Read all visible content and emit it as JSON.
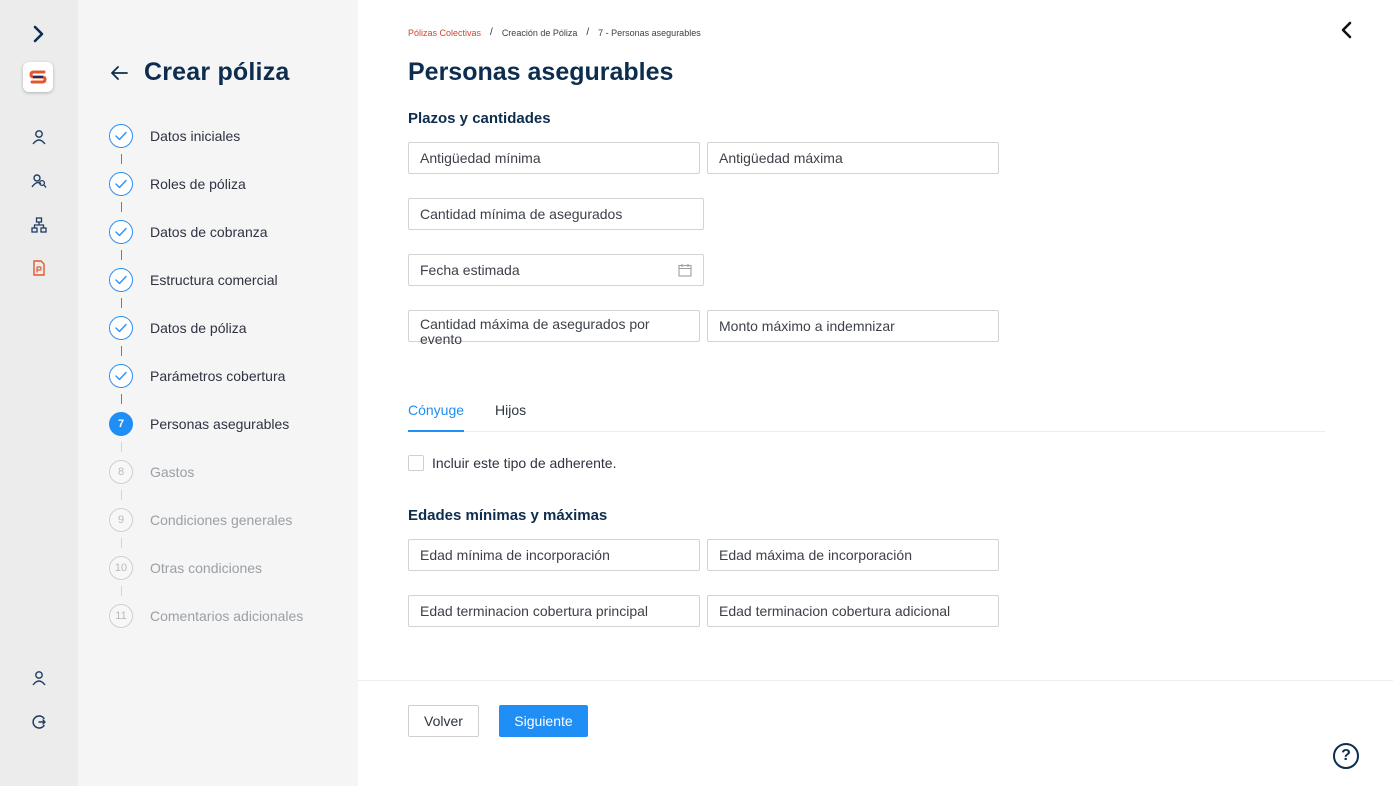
{
  "sidebar": {
    "logo_letter": "S",
    "nav_icons": [
      "chevron-right-icon",
      "user-icon",
      "users-search-icon",
      "org-chart-icon",
      "document-icon"
    ],
    "bottom_icons": [
      "user-icon",
      "logout-icon"
    ],
    "colors": {
      "rail_bg": "#ececec",
      "icon": "#1f3b63",
      "active_icon": "#e4572e"
    }
  },
  "steps_panel": {
    "title": "Crear póliza",
    "steps": [
      {
        "number": "1",
        "label": "Datos iniciales",
        "status": "done"
      },
      {
        "number": "2",
        "label": "Roles de póliza",
        "status": "done"
      },
      {
        "number": "3",
        "label": "Datos de cobranza",
        "status": "done"
      },
      {
        "number": "4",
        "label": "Estructura comercial",
        "status": "done"
      },
      {
        "number": "5",
        "label": "Datos de póliza",
        "status": "done"
      },
      {
        "number": "6",
        "label": "Parámetros cobertura",
        "status": "done"
      },
      {
        "number": "7",
        "label": "Personas asegurables",
        "status": "active"
      },
      {
        "number": "8",
        "label": "Gastos",
        "status": "todo"
      },
      {
        "number": "9",
        "label": "Condiciones generales",
        "status": "todo"
      },
      {
        "number": "10",
        "label": "Otras condiciones",
        "status": "todo"
      },
      {
        "number": "11",
        "label": "Comentarios adicionales",
        "status": "todo"
      }
    ]
  },
  "breadcrumb": {
    "items": [
      "Pólizas Colectivas",
      "Creación de Póliza",
      "7 - Personas asegurables"
    ],
    "separator": "/"
  },
  "main": {
    "title": "Personas asegurables",
    "plazos_section": {
      "title": "Plazos y cantidades",
      "fields": {
        "antiguedad_minima": "Antigüedad mínima",
        "antiguedad_maxima": "Antigüedad máxima",
        "cantidad_minima": "Cantidad mínima de asegurados",
        "fecha_estimada": "Fecha estimada",
        "cantidad_maxima_evento": "Cantidad máxima de asegurados por evento",
        "monto_maximo": "Monto máximo a indemnizar"
      }
    },
    "tabs": [
      {
        "label": "Cónyuge",
        "active": true
      },
      {
        "label": "Hijos",
        "active": false
      }
    ],
    "include_checkbox": {
      "label": "Incluir este tipo de adherente.",
      "checked": false
    },
    "edades_section": {
      "title": "Edades mínimas y máximas",
      "fields": {
        "edad_min_incorporacion": "Edad mínima de incorporación",
        "edad_max_incorporacion": "Edad máxima de incorporación",
        "edad_term_principal": "Edad terminacion cobertura principal",
        "edad_term_adicional": "Edad terminacion cobertura adicional"
      }
    }
  },
  "footer": {
    "back_label": "Volver",
    "next_label": "Siguiente",
    "help_label": "?"
  },
  "colors": {
    "primary": "#1f8ef5",
    "heading": "#0d2d4e",
    "breadcrumb_link": "#d4442d"
  }
}
